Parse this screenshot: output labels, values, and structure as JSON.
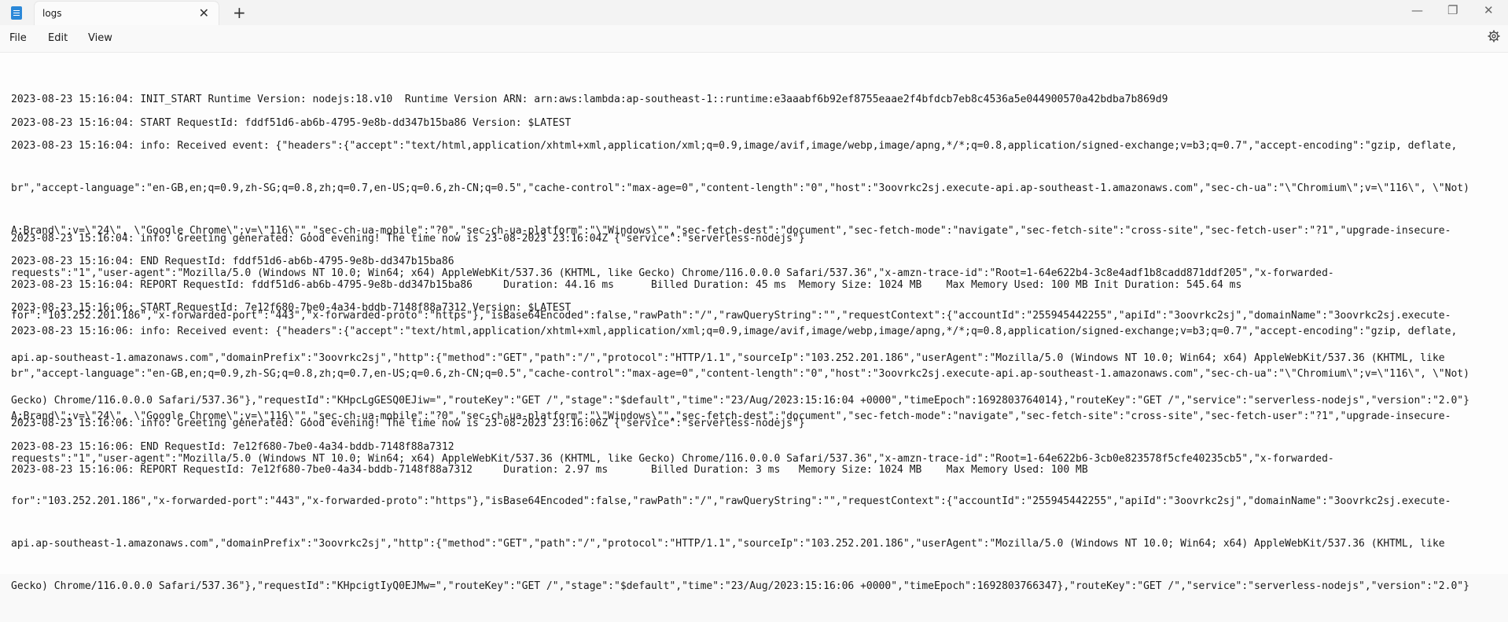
{
  "titlebar": {
    "tab_title": "logs",
    "close_glyph": "✕",
    "new_tab_glyph": "+",
    "minimize_glyph": "—",
    "maximize_glyph": "❐",
    "window_close_glyph": "✕"
  },
  "menu": {
    "file": "File",
    "edit": "Edit",
    "view": "View"
  },
  "editor": {
    "lines": [
      [
        "2023-08-23 15:16:04: INIT_START Runtime Version: nodejs:18.v10  Runtime Version ARN: arn:aws:lambda:ap-southeast-1::runtime:e3aaabf6b92ef8755eaae2f4bfdcb7eb8c4536a5e044900570a42bdba7b869d9"
      ],
      [
        "2023-08-23 15:16:04: START RequestId: fddf51d6-ab6b-4795-9e8b-dd347b15ba86 Version: $LATEST"
      ],
      [
        "2023-08-23 15:16:04: info: Received event: {\"headers\":{\"accept\":\"text/html,application/xhtml+xml,application/xml;q=0.9,image/avif,image/webp,image/apng,*/*;q=0.8,application/signed-exchange;v=b3;q=0.7\",\"accept-encoding\":\"gzip, deflate,",
        "br\",\"accept-language\":\"en-GB,en;q=0.9,zh-SG;q=0.8,zh;q=0.7,en-US;q=0.6,zh-CN;q=0.5\",\"cache-control\":\"max-age=0\",\"content-length\":\"0\",\"host\":\"3oovrkc2sj.execute-api.ap-southeast-1.amazonaws.com\",\"sec-ch-ua\":\"\\\"Chromium\\\";v=\\\"116\\\", \\\"Not)",
        "A;Brand\\\";v=\\\"24\\\", \\\"Google Chrome\\\";v=\\\"116\\\"\",\"sec-ch-ua-mobile\":\"?0\",\"sec-ch-ua-platform\":\"\\\"Windows\\\"\",\"sec-fetch-dest\":\"document\",\"sec-fetch-mode\":\"navigate\",\"sec-fetch-site\":\"cross-site\",\"sec-fetch-user\":\"?1\",\"upgrade-insecure-",
        "requests\":\"1\",\"user-agent\":\"Mozilla/5.0 (Windows NT 10.0; Win64; x64) AppleWebKit/537.36 (KHTML, like Gecko) Chrome/116.0.0.0 Safari/537.36\",\"x-amzn-trace-id\":\"Root=1-64e622b4-3c8e4adf1b8cadd871ddf205\",\"x-forwarded-",
        "for\":\"103.252.201.186\",\"x-forwarded-port\":\"443\",\"x-forwarded-proto\":\"https\"},\"isBase64Encoded\":false,\"rawPath\":\"/\",\"rawQueryString\":\"\",\"requestContext\":{\"accountId\":\"255945442255\",\"apiId\":\"3oovrkc2sj\",\"domainName\":\"3oovrkc2sj.execute-",
        "api.ap-southeast-1.amazonaws.com\",\"domainPrefix\":\"3oovrkc2sj\",\"http\":{\"method\":\"GET\",\"path\":\"/\",\"protocol\":\"HTTP/1.1\",\"sourceIp\":\"103.252.201.186\",\"userAgent\":\"Mozilla/5.0 (Windows NT 10.0; Win64; x64) AppleWebKit/537.36 (KHTML, like",
        "Gecko) Chrome/116.0.0.0 Safari/537.36\"},\"requestId\":\"KHpcLgGESQ0EJiw=\",\"routeKey\":\"GET /\",\"stage\":\"$default\",\"time\":\"23/Aug/2023:15:16:04 +0000\",\"timeEpoch\":1692803764014},\"routeKey\":\"GET /\",\"service\":\"serverless-nodejs\",\"version\":\"2.0\"}"
      ],
      [
        "2023-08-23 15:16:04: info: Greeting generated: Good evening! The time now is 23-08-2023 23:16:04Z {\"service\":\"serverless-nodejs\"}"
      ],
      [
        "2023-08-23 15:16:04: END RequestId: fddf51d6-ab6b-4795-9e8b-dd347b15ba86"
      ],
      [
        "2023-08-23 15:16:04: REPORT RequestId: fddf51d6-ab6b-4795-9e8b-dd347b15ba86     Duration: 44.16 ms      Billed Duration: 45 ms  Memory Size: 1024 MB    Max Memory Used: 100 MB Init Duration: 545.64 ms"
      ],
      [
        "2023-08-23 15:16:06: START RequestId: 7e12f680-7be0-4a34-bddb-7148f88a7312 Version: $LATEST"
      ],
      [
        "2023-08-23 15:16:06: info: Received event: {\"headers\":{\"accept\":\"text/html,application/xhtml+xml,application/xml;q=0.9,image/avif,image/webp,image/apng,*/*;q=0.8,application/signed-exchange;v=b3;q=0.7\",\"accept-encoding\":\"gzip, deflate,",
        "br\",\"accept-language\":\"en-GB,en;q=0.9,zh-SG;q=0.8,zh;q=0.7,en-US;q=0.6,zh-CN;q=0.5\",\"cache-control\":\"max-age=0\",\"content-length\":\"0\",\"host\":\"3oovrkc2sj.execute-api.ap-southeast-1.amazonaws.com\",\"sec-ch-ua\":\"\\\"Chromium\\\";v=\\\"116\\\", \\\"Not)",
        "A;Brand\\\";v=\\\"24\\\", \\\"Google Chrome\\\";v=\\\"116\\\"\",\"sec-ch-ua-mobile\":\"?0\",\"sec-ch-ua-platform\":\"\\\"Windows\\\"\",\"sec-fetch-dest\":\"document\",\"sec-fetch-mode\":\"navigate\",\"sec-fetch-site\":\"cross-site\",\"sec-fetch-user\":\"?1\",\"upgrade-insecure-",
        "requests\":\"1\",\"user-agent\":\"Mozilla/5.0 (Windows NT 10.0; Win64; x64) AppleWebKit/537.36 (KHTML, like Gecko) Chrome/116.0.0.0 Safari/537.36\",\"x-amzn-trace-id\":\"Root=1-64e622b6-3cb0e823578f5cfe40235cb5\",\"x-forwarded-",
        "for\":\"103.252.201.186\",\"x-forwarded-port\":\"443\",\"x-forwarded-proto\":\"https\"},\"isBase64Encoded\":false,\"rawPath\":\"/\",\"rawQueryString\":\"\",\"requestContext\":{\"accountId\":\"255945442255\",\"apiId\":\"3oovrkc2sj\",\"domainName\":\"3oovrkc2sj.execute-",
        "api.ap-southeast-1.amazonaws.com\",\"domainPrefix\":\"3oovrkc2sj\",\"http\":{\"method\":\"GET\",\"path\":\"/\",\"protocol\":\"HTTP/1.1\",\"sourceIp\":\"103.252.201.186\",\"userAgent\":\"Mozilla/5.0 (Windows NT 10.0; Win64; x64) AppleWebKit/537.36 (KHTML, like",
        "Gecko) Chrome/116.0.0.0 Safari/537.36\"},\"requestId\":\"KHpcigtIyQ0EJMw=\",\"routeKey\":\"GET /\",\"stage\":\"$default\",\"time\":\"23/Aug/2023:15:16:06 +0000\",\"timeEpoch\":1692803766347},\"routeKey\":\"GET /\",\"service\":\"serverless-nodejs\",\"version\":\"2.0\"}"
      ],
      [
        "2023-08-23 15:16:06: info: Greeting generated: Good evening! The time now is 23-08-2023 23:16:06Z {\"service\":\"serverless-nodejs\"}"
      ],
      [
        "2023-08-23 15:16:06: END RequestId: 7e12f680-7be0-4a34-bddb-7148f88a7312"
      ],
      [
        "2023-08-23 15:16:06: REPORT RequestId: 7e12f680-7be0-4a34-bddb-7148f88a7312     Duration: 2.97 ms       Billed Duration: 3 ms   Memory Size: 1024 MB    Max Memory Used: 100 MB"
      ]
    ]
  }
}
